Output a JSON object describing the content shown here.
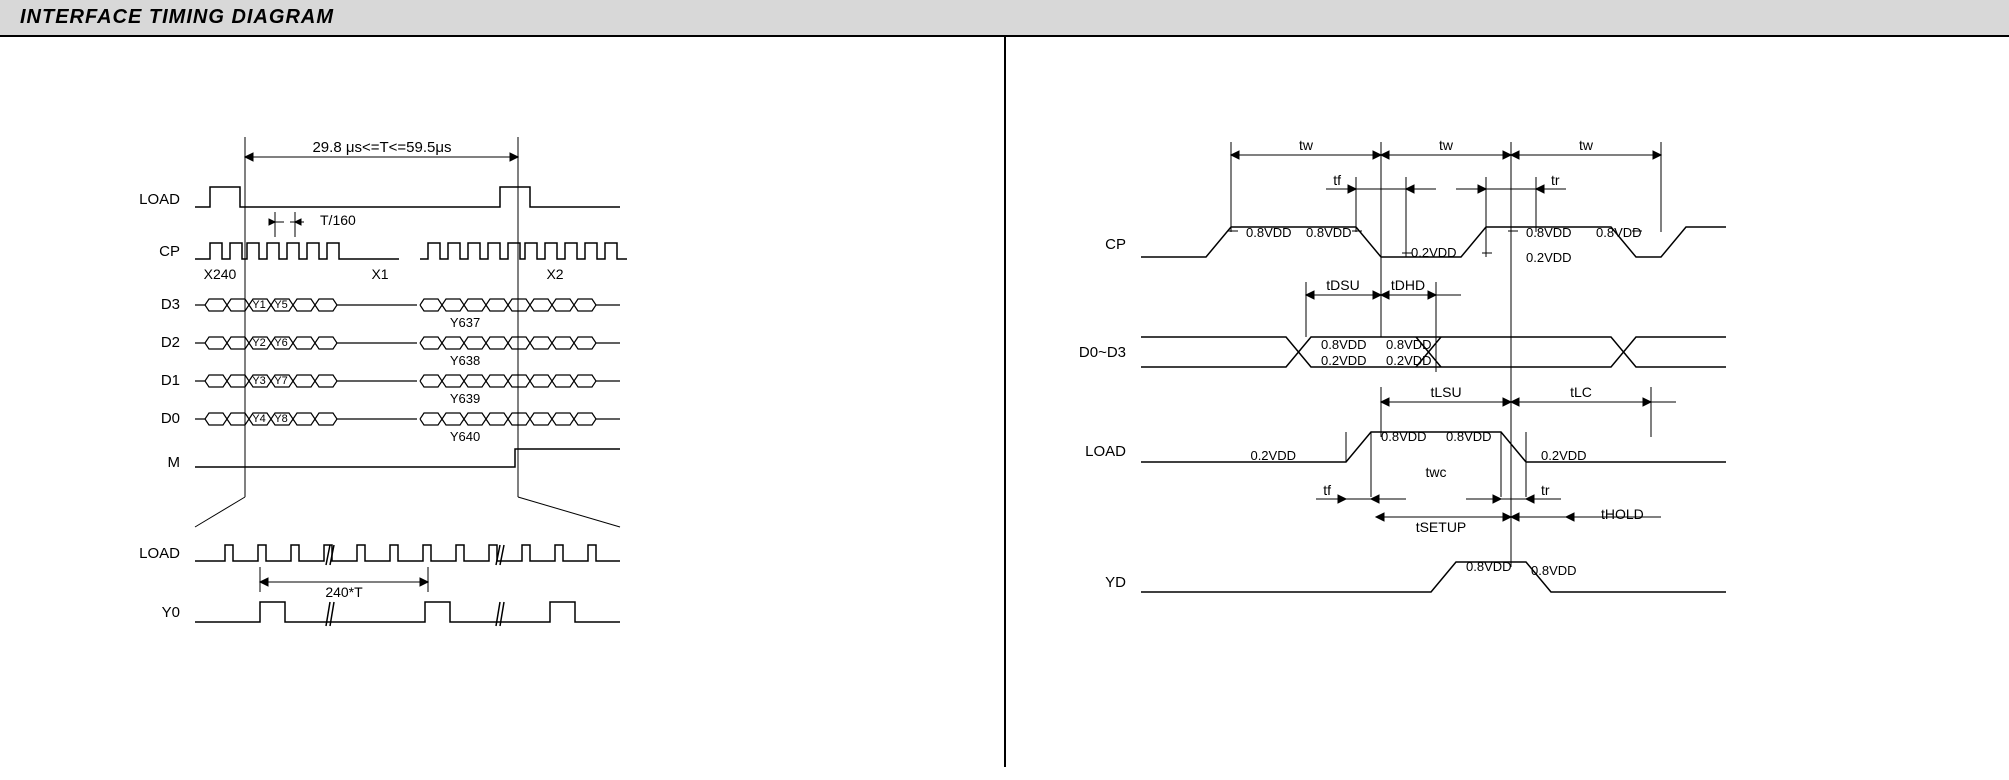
{
  "title": "INTERFACE TIMING DIAGRAM",
  "left": {
    "period_spec": "29.8 μs<=T<=59.5μs",
    "clock_div": "T/160",
    "sig": {
      "load": "LOAD",
      "cp": "CP",
      "d3": "D3",
      "d2": "D2",
      "d1": "D1",
      "d0": "D0",
      "m": "M",
      "load2": "LOAD",
      "y0": "Y0"
    },
    "col_prev": "X240",
    "col_cur": "X1",
    "col_next": "X2",
    "y1": "Y1",
    "y5": "Y5",
    "y637": "Y637",
    "y2": "Y2",
    "y6": "Y6",
    "y638": "Y638",
    "y3": "Y3",
    "y7": "Y7",
    "y639": "Y639",
    "y4": "Y4",
    "y8": "Y8",
    "y640": "Y640",
    "frame_period": "240*T"
  },
  "right": {
    "sig": {
      "cp": "CP",
      "data": "D0~D3",
      "load": "LOAD",
      "yd": "YD"
    },
    "tw": "tw",
    "tf": "tf",
    "tr": "tr",
    "v08": "0.8VDD",
    "v02": "0.2VDD",
    "tdsu": "tDSU",
    "tdhd": "tDHD",
    "tlsu": "tLSU",
    "tlc": "tLC",
    "twc": "twc",
    "tsetup": "tSETUP",
    "thold": "tHOLD"
  }
}
